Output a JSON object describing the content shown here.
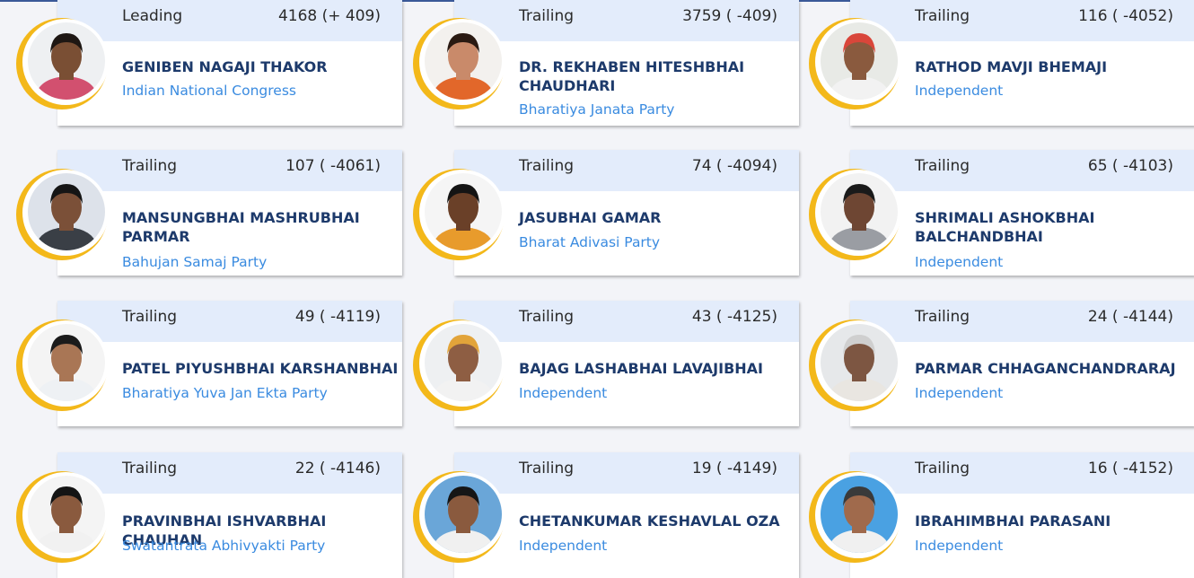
{
  "candidates": [
    {
      "status": "Leading",
      "votes": "4168 (+ 409)",
      "name": "GENIBEN NAGAJI THAKOR",
      "party": "Indian National Congress",
      "photo": {
        "bg": "#eef0f2",
        "skin": "#7a4f34",
        "hair": "#1e1713",
        "shirt": "#d2506f"
      }
    },
    {
      "status": "Trailing",
      "votes": "3759 ( -409)",
      "name": "DR. REKHABEN HITESHBHAI CHAUDHARI",
      "party": "Bharatiya Janata Party",
      "photo": {
        "bg": "#f3f1ee",
        "skin": "#c98a6a",
        "hair": "#2a1a12",
        "shirt": "#e2672a"
      }
    },
    {
      "status": "Trailing",
      "votes": "116 ( -4052)",
      "name": "RATHOD MAVJI BHEMAJI",
      "party": "Independent",
      "photo": {
        "bg": "#e8eae6",
        "skin": "#8a5a3e",
        "hair": "#d9463a",
        "shirt": "#f2f2f2"
      }
    },
    {
      "status": "Trailing",
      "votes": "107 ( -4061)",
      "name": "MANSUNGBHAI MASHRUBHAI PARMAR",
      "party": "Bahujan Samaj Party",
      "photo": {
        "bg": "#dde2ea",
        "skin": "#7b5038",
        "hair": "#151515",
        "shirt": "#3a3f46"
      }
    },
    {
      "status": "Trailing",
      "votes": "74 ( -4094)",
      "name": "JASUBHAI GAMAR",
      "party": "Bharat Adivasi Party",
      "photo": {
        "bg": "#f5f5f5",
        "skin": "#6a4028",
        "hair": "#141414",
        "shirt": "#e89b2c"
      }
    },
    {
      "status": "Trailing",
      "votes": "65 ( -4103)",
      "name": "SHRIMALI ASHOKBHAI BALCHANDBHAI",
      "party": "Independent",
      "photo": {
        "bg": "#f2f2f2",
        "skin": "#6e4633",
        "hair": "#1a1a1a",
        "shirt": "#9a9da3"
      }
    },
    {
      "status": "Trailing",
      "votes": "49 ( -4119)",
      "name": "PATEL PIYUSHBHAI KARSHANBHAI",
      "party": "Bharatiya Yuva Jan Ekta Party",
      "photo": {
        "bg": "#f4f4f4",
        "skin": "#a97655",
        "hair": "#1b1b1b",
        "shirt": "#eef1f4"
      }
    },
    {
      "status": "Trailing",
      "votes": "43 ( -4125)",
      "name": "BAJAG LASHABHAI LAVAJIBHAI",
      "party": "Independent",
      "photo": {
        "bg": "#eef0f2",
        "skin": "#8e5e43",
        "hair": "#e2a43a",
        "shirt": "#f2f2f2"
      }
    },
    {
      "status": "Trailing",
      "votes": "24 ( -4144)",
      "name": "PARMAR CHHAGANCHANDRARAJ",
      "party": "Independent",
      "photo": {
        "bg": "#e6e8ea",
        "skin": "#7d5642",
        "hair": "#cfcfcf",
        "shirt": "#e9e6e1"
      }
    },
    {
      "status": "Trailing",
      "votes": "22 ( -4146)",
      "name": "PRAVINBHAI ISHVARBHAI CHAUHAN",
      "party": "Swatantrata Abhivyakti Party",
      "photo": {
        "bg": "#f4f4f4",
        "skin": "#8a5a3e",
        "hair": "#141414",
        "shirt": "#f1f1f1"
      }
    },
    {
      "status": "Trailing",
      "votes": "19 ( -4149)",
      "name": "CHETANKUMAR KESHAVLAL OZA",
      "party": "Independent",
      "photo": {
        "bg": "#6aa6d8",
        "skin": "#8a5a3e",
        "hair": "#161616",
        "shirt": "#f0f0f0"
      }
    },
    {
      "status": "Trailing",
      "votes": "16 ( -4152)",
      "name": "IBRAHIMBHAI PARASANI",
      "party": "Independent",
      "photo": {
        "bg": "#4aa1e2",
        "skin": "#a06a4c",
        "hair": "#3a3a3a",
        "shirt": "#f0f0f0"
      }
    }
  ]
}
